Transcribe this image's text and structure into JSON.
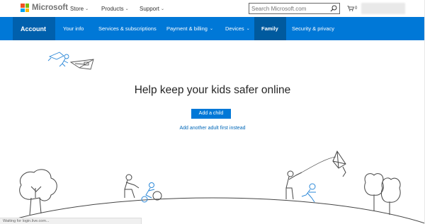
{
  "header": {
    "brand": "Microsoft",
    "nav": [
      {
        "label": "Store"
      },
      {
        "label": "Products"
      },
      {
        "label": "Support"
      }
    ],
    "search_placeholder": "Search Microsoft.com",
    "cart_count": "0"
  },
  "account_nav": {
    "title": "Account",
    "items": [
      {
        "label": "Your info"
      },
      {
        "label": "Services & subscriptions"
      },
      {
        "label": "Payment & billing"
      },
      {
        "label": "Devices"
      },
      {
        "label": "Family"
      },
      {
        "label": "Security & privacy"
      }
    ]
  },
  "main": {
    "headline": "Help keep your kids safer online",
    "add_child_label": "Add a child",
    "add_adult_link": "Add another adult first instead"
  },
  "status_bar": {
    "text": "Waiting for login.live.com..."
  },
  "colors": {
    "accent": "#0078d7",
    "accent_dark": "#0060ad",
    "link": "#0067b8",
    "illustration_blue": "#2b88d8"
  },
  "icons": [
    "search-icon",
    "cart-icon",
    "chevron-down-icon"
  ]
}
